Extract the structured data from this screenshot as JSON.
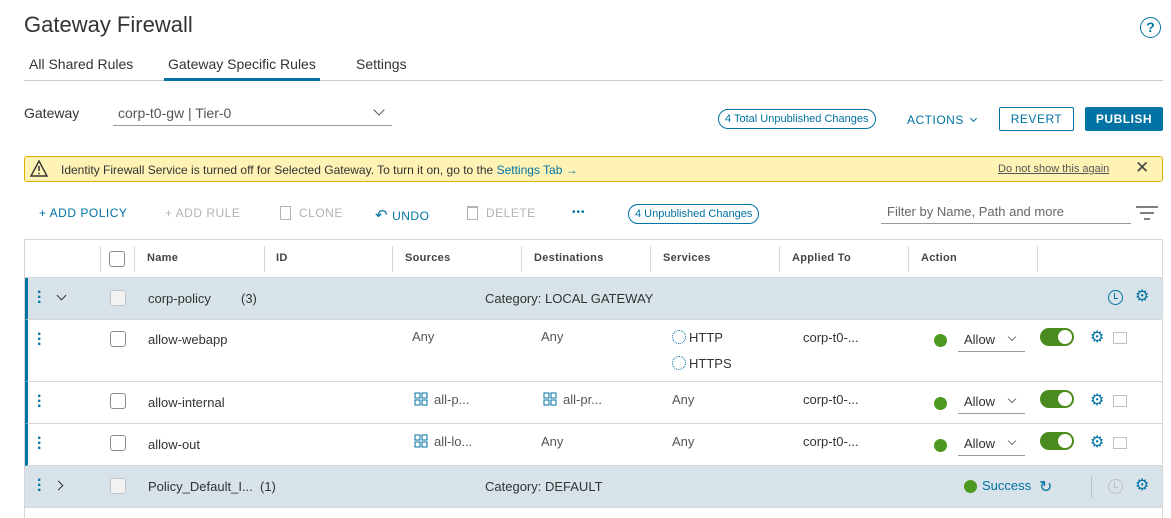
{
  "page": {
    "title": "Gateway Firewall",
    "help_label": "?"
  },
  "tabs": [
    {
      "label": "All Shared Rules",
      "active": false
    },
    {
      "label": "Gateway Specific Rules",
      "active": true
    },
    {
      "label": "Settings",
      "active": false
    }
  ],
  "gateway": {
    "label": "Gateway",
    "selected": "corp-t0-gw | Tier-0"
  },
  "header_actions": {
    "total_unpublished": "4 Total Unpublished Changes",
    "actions_label": "ACTIONS",
    "revert_label": "REVERT",
    "publish_label": "PUBLISH"
  },
  "alert": {
    "message": "Identity Firewall Service is turned off for Selected Gateway. To turn it on, go to the",
    "link": "Settings Tab →",
    "dismiss": "Do not show this again",
    "close": "✕"
  },
  "toolbar": {
    "add_policy": "+ ADD POLICY",
    "add_rule": "+ ADD RULE",
    "clone": "CLONE",
    "undo": "UNDO",
    "delete": "DELETE",
    "more": "•••",
    "unpublished": "4 Unpublished Changes",
    "filter_placeholder": "Filter by Name, Path and more"
  },
  "table": {
    "columns": [
      "Name",
      "ID",
      "Sources",
      "Destinations",
      "Services",
      "Applied To",
      "Action"
    ],
    "policies": [
      {
        "name": "corp-policy",
        "count": "(3)",
        "category": "Category: LOCAL GATEWAY",
        "rules": [
          {
            "name": "allow-webapp",
            "sources": "Any",
            "destinations": "Any",
            "services": [
              "HTTP",
              "HTTPS"
            ],
            "applied_to": "corp-t0-...",
            "action": "Allow"
          },
          {
            "name": "allow-internal",
            "sources": "all-p...",
            "destinations": "all-pr...",
            "services": [
              "Any"
            ],
            "applied_to": "corp-t0-...",
            "action": "Allow"
          },
          {
            "name": "allow-out",
            "sources": "all-lo...",
            "destinations": "Any",
            "services": [
              "Any"
            ],
            "applied_to": "corp-t0-...",
            "action": "Allow"
          }
        ]
      },
      {
        "name": "Policy_Default_I...",
        "count": "(1)",
        "category": "Category: DEFAULT",
        "status": "Success"
      }
    ]
  },
  "colors": {
    "accent": "#0072a3",
    "success": "#4b9a1f",
    "policy_row": "#d8e3e9",
    "alert_bg": "#fef3b5"
  }
}
